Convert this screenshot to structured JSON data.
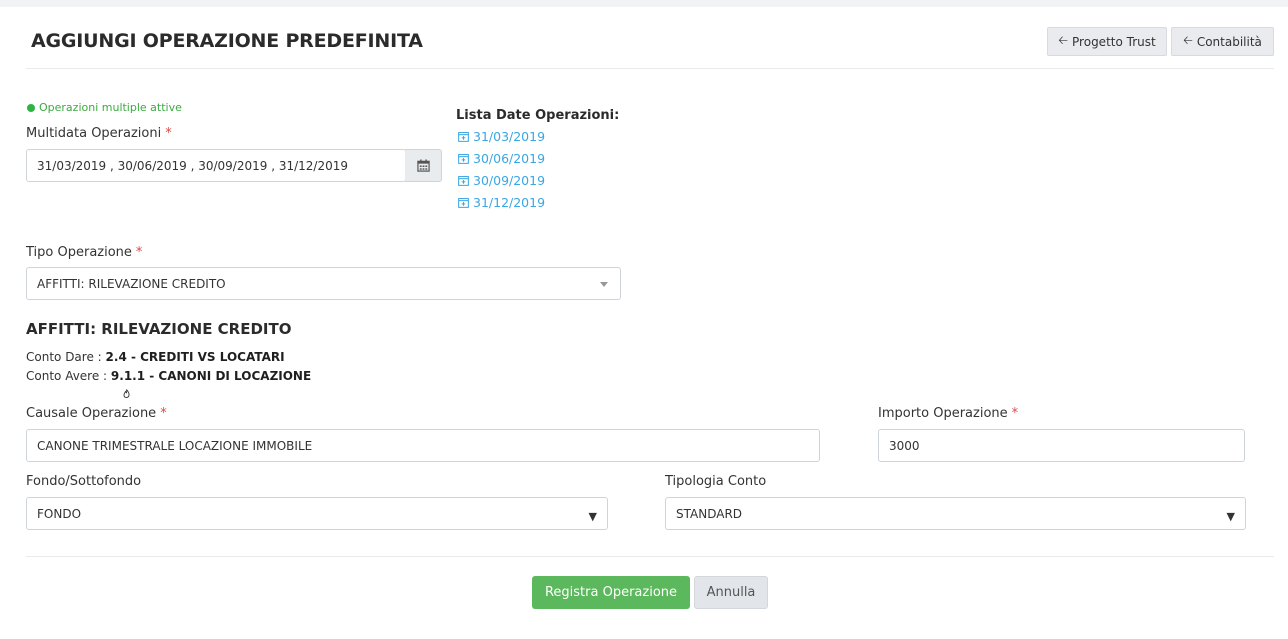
{
  "header": {
    "title": "AGGIUNGI OPERAZIONE PREDEFINITA",
    "btn_project": "Progetto Trust",
    "btn_accounting": "Contabilità"
  },
  "status": {
    "text": "Operazioni multiple attive",
    "color": "#2fb344"
  },
  "multidate": {
    "label": "Multidata Operazioni",
    "required": "*",
    "value": "31/03/2019 , 30/06/2019 , 30/09/2019 , 31/12/2019",
    "icon": "calendar-icon"
  },
  "dates_list": {
    "title": "Lista Date Operazioni:",
    "items": [
      "31/03/2019",
      "30/06/2019",
      "30/09/2019",
      "31/12/2019"
    ],
    "icon": "calendar-plus-icon",
    "color": "#3aa6e4"
  },
  "operation_type": {
    "label": "Tipo Operazione",
    "required": "*",
    "value": "AFFITTI: RILEVAZIONE CREDITO"
  },
  "operation_detail": {
    "title": "AFFITTI: RILEVAZIONE CREDITO",
    "dare_label": "Conto Dare :",
    "dare_value": "2.4 - CREDITI VS LOCATARI",
    "avere_label": "Conto Avere :",
    "avere_value": "9.1.1 - CANONI DI LOCAZIONE"
  },
  "causale": {
    "label": "Causale Operazione",
    "required": "*",
    "value": "CANONE TRIMESTRALE LOCAZIONE IMMOBILE"
  },
  "importo": {
    "label": "Importo Operazione",
    "required": "*",
    "value": "3000"
  },
  "fondo": {
    "label": "Fondo/Sottofondo",
    "value": "FONDO"
  },
  "tipologia": {
    "label": "Tipologia Conto",
    "value": "STANDARD"
  },
  "actions": {
    "submit": "Registra Operazione",
    "cancel": "Annulla",
    "submit_color": "#5cb85c"
  }
}
